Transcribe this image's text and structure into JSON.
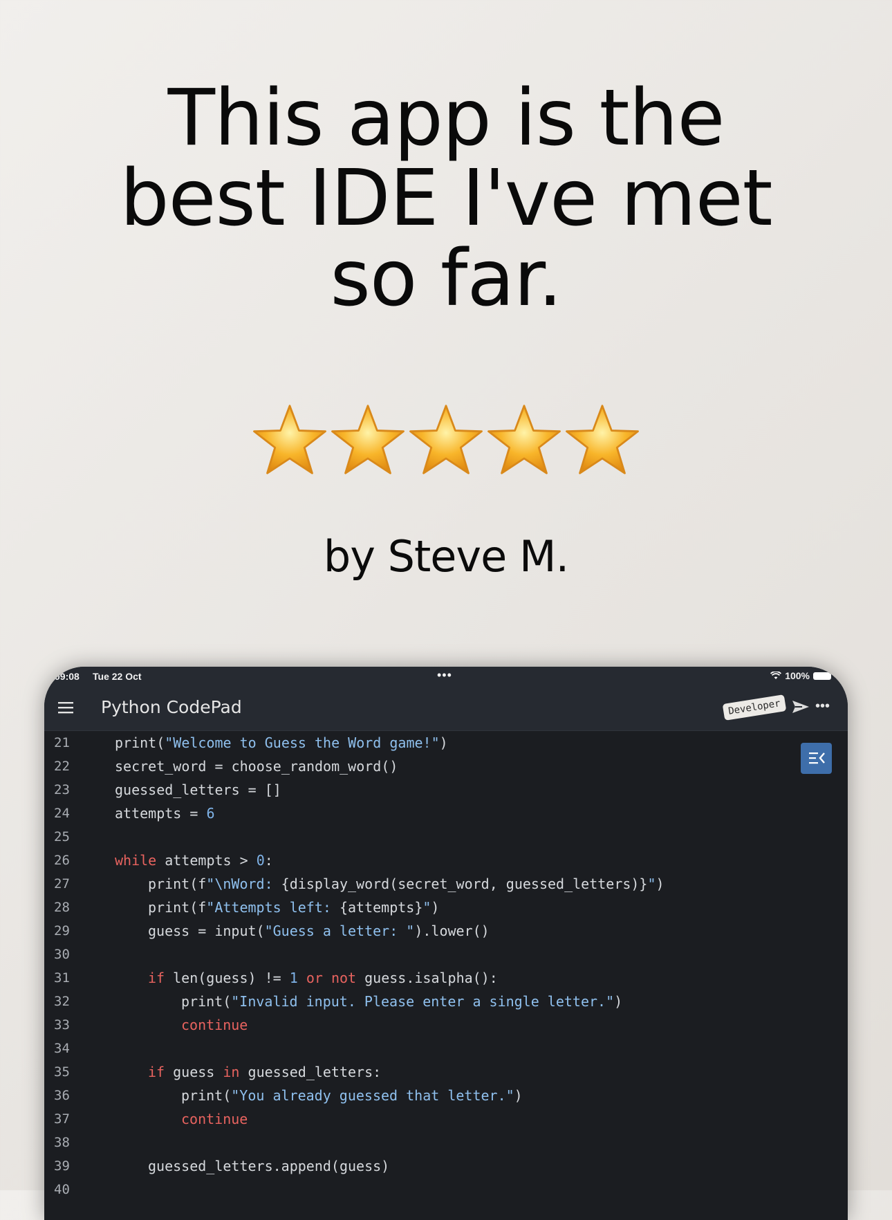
{
  "headline": {
    "line1": "This app is the",
    "line2": "best IDE I've met",
    "line3": "so far."
  },
  "rating": {
    "stars": 5,
    "max": 5
  },
  "byline": "by Steve M.",
  "device": {
    "status": {
      "time": "09:08",
      "date": "Tue 22 Oct",
      "battery": "100%"
    },
    "app_title": "Python CodePad",
    "badge": "Developer",
    "code_lines": [
      {
        "n": "21",
        "indent": 0,
        "tokens": [
          [
            "",
            "print("
          ],
          [
            "str",
            "\"Welcome to Guess the Word game!\""
          ],
          [
            "",
            ")"
          ]
        ]
      },
      {
        "n": "22",
        "indent": 0,
        "tokens": [
          [
            "",
            "secret_word = choose_random_word()"
          ]
        ]
      },
      {
        "n": "23",
        "indent": 0,
        "tokens": [
          [
            "",
            "guessed_letters = []"
          ]
        ]
      },
      {
        "n": "24",
        "indent": 0,
        "tokens": [
          [
            "",
            "attempts = "
          ],
          [
            "num",
            "6"
          ]
        ]
      },
      {
        "n": "25",
        "indent": 0,
        "tokens": []
      },
      {
        "n": "26",
        "indent": 0,
        "tokens": [
          [
            "kw",
            "while"
          ],
          [
            "",
            " attempts > "
          ],
          [
            "num",
            "0"
          ],
          [
            "",
            ":"
          ]
        ]
      },
      {
        "n": "27",
        "indent": 1,
        "tokens": [
          [
            "",
            "print(f"
          ],
          [
            "str",
            "\"\\nWord: "
          ],
          [
            "",
            "{display_word(secret_word, guessed_letters)}"
          ],
          [
            "str",
            "\""
          ],
          [
            "",
            ")"
          ]
        ]
      },
      {
        "n": "28",
        "indent": 1,
        "tokens": [
          [
            "",
            "print(f"
          ],
          [
            "str",
            "\"Attempts left: "
          ],
          [
            "",
            "{attempts}"
          ],
          [
            "str",
            "\""
          ],
          [
            "",
            ")"
          ]
        ]
      },
      {
        "n": "29",
        "indent": 1,
        "tokens": [
          [
            "",
            "guess = input("
          ],
          [
            "str",
            "\"Guess a letter: \""
          ],
          [
            "",
            ").lower()"
          ]
        ]
      },
      {
        "n": "30",
        "indent": 0,
        "tokens": []
      },
      {
        "n": "31",
        "indent": 1,
        "tokens": [
          [
            "kw",
            "if"
          ],
          [
            "",
            " len(guess) != "
          ],
          [
            "num",
            "1"
          ],
          [
            "",
            " "
          ],
          [
            "kw",
            "or"
          ],
          [
            "",
            " "
          ],
          [
            "kw",
            "not"
          ],
          [
            "",
            " guess.isalpha():"
          ]
        ]
      },
      {
        "n": "32",
        "indent": 2,
        "tokens": [
          [
            "",
            "print("
          ],
          [
            "str",
            "\"Invalid input. Please enter a single letter.\""
          ],
          [
            "",
            ")"
          ]
        ]
      },
      {
        "n": "33",
        "indent": 2,
        "tokens": [
          [
            "kw",
            "continue"
          ]
        ]
      },
      {
        "n": "34",
        "indent": 0,
        "tokens": []
      },
      {
        "n": "35",
        "indent": 1,
        "tokens": [
          [
            "kw",
            "if"
          ],
          [
            "",
            " guess "
          ],
          [
            "kw",
            "in"
          ],
          [
            "",
            " guessed_letters:"
          ]
        ]
      },
      {
        "n": "36",
        "indent": 2,
        "tokens": [
          [
            "",
            "print("
          ],
          [
            "str",
            "\"You already guessed that letter.\""
          ],
          [
            "",
            ")"
          ]
        ]
      },
      {
        "n": "37",
        "indent": 2,
        "tokens": [
          [
            "kw",
            "continue"
          ]
        ]
      },
      {
        "n": "38",
        "indent": 0,
        "tokens": []
      },
      {
        "n": "39",
        "indent": 1,
        "tokens": [
          [
            "",
            "guessed_letters.append(guess)"
          ]
        ]
      },
      {
        "n": "40",
        "indent": 0,
        "tokens": []
      }
    ]
  },
  "colors": {
    "keyword": "#e8635f",
    "string": "#8fc0ee",
    "number": "#7fb3e8",
    "editor_bg": "#1b1d21",
    "toolbar_bg": "#262a31",
    "accent_button": "#3e6eaa",
    "star": "#f8b52a"
  },
  "icons": [
    "menu-icon",
    "send-icon",
    "more-icon",
    "outline-toggle-icon",
    "wifi-icon",
    "battery-icon"
  ]
}
